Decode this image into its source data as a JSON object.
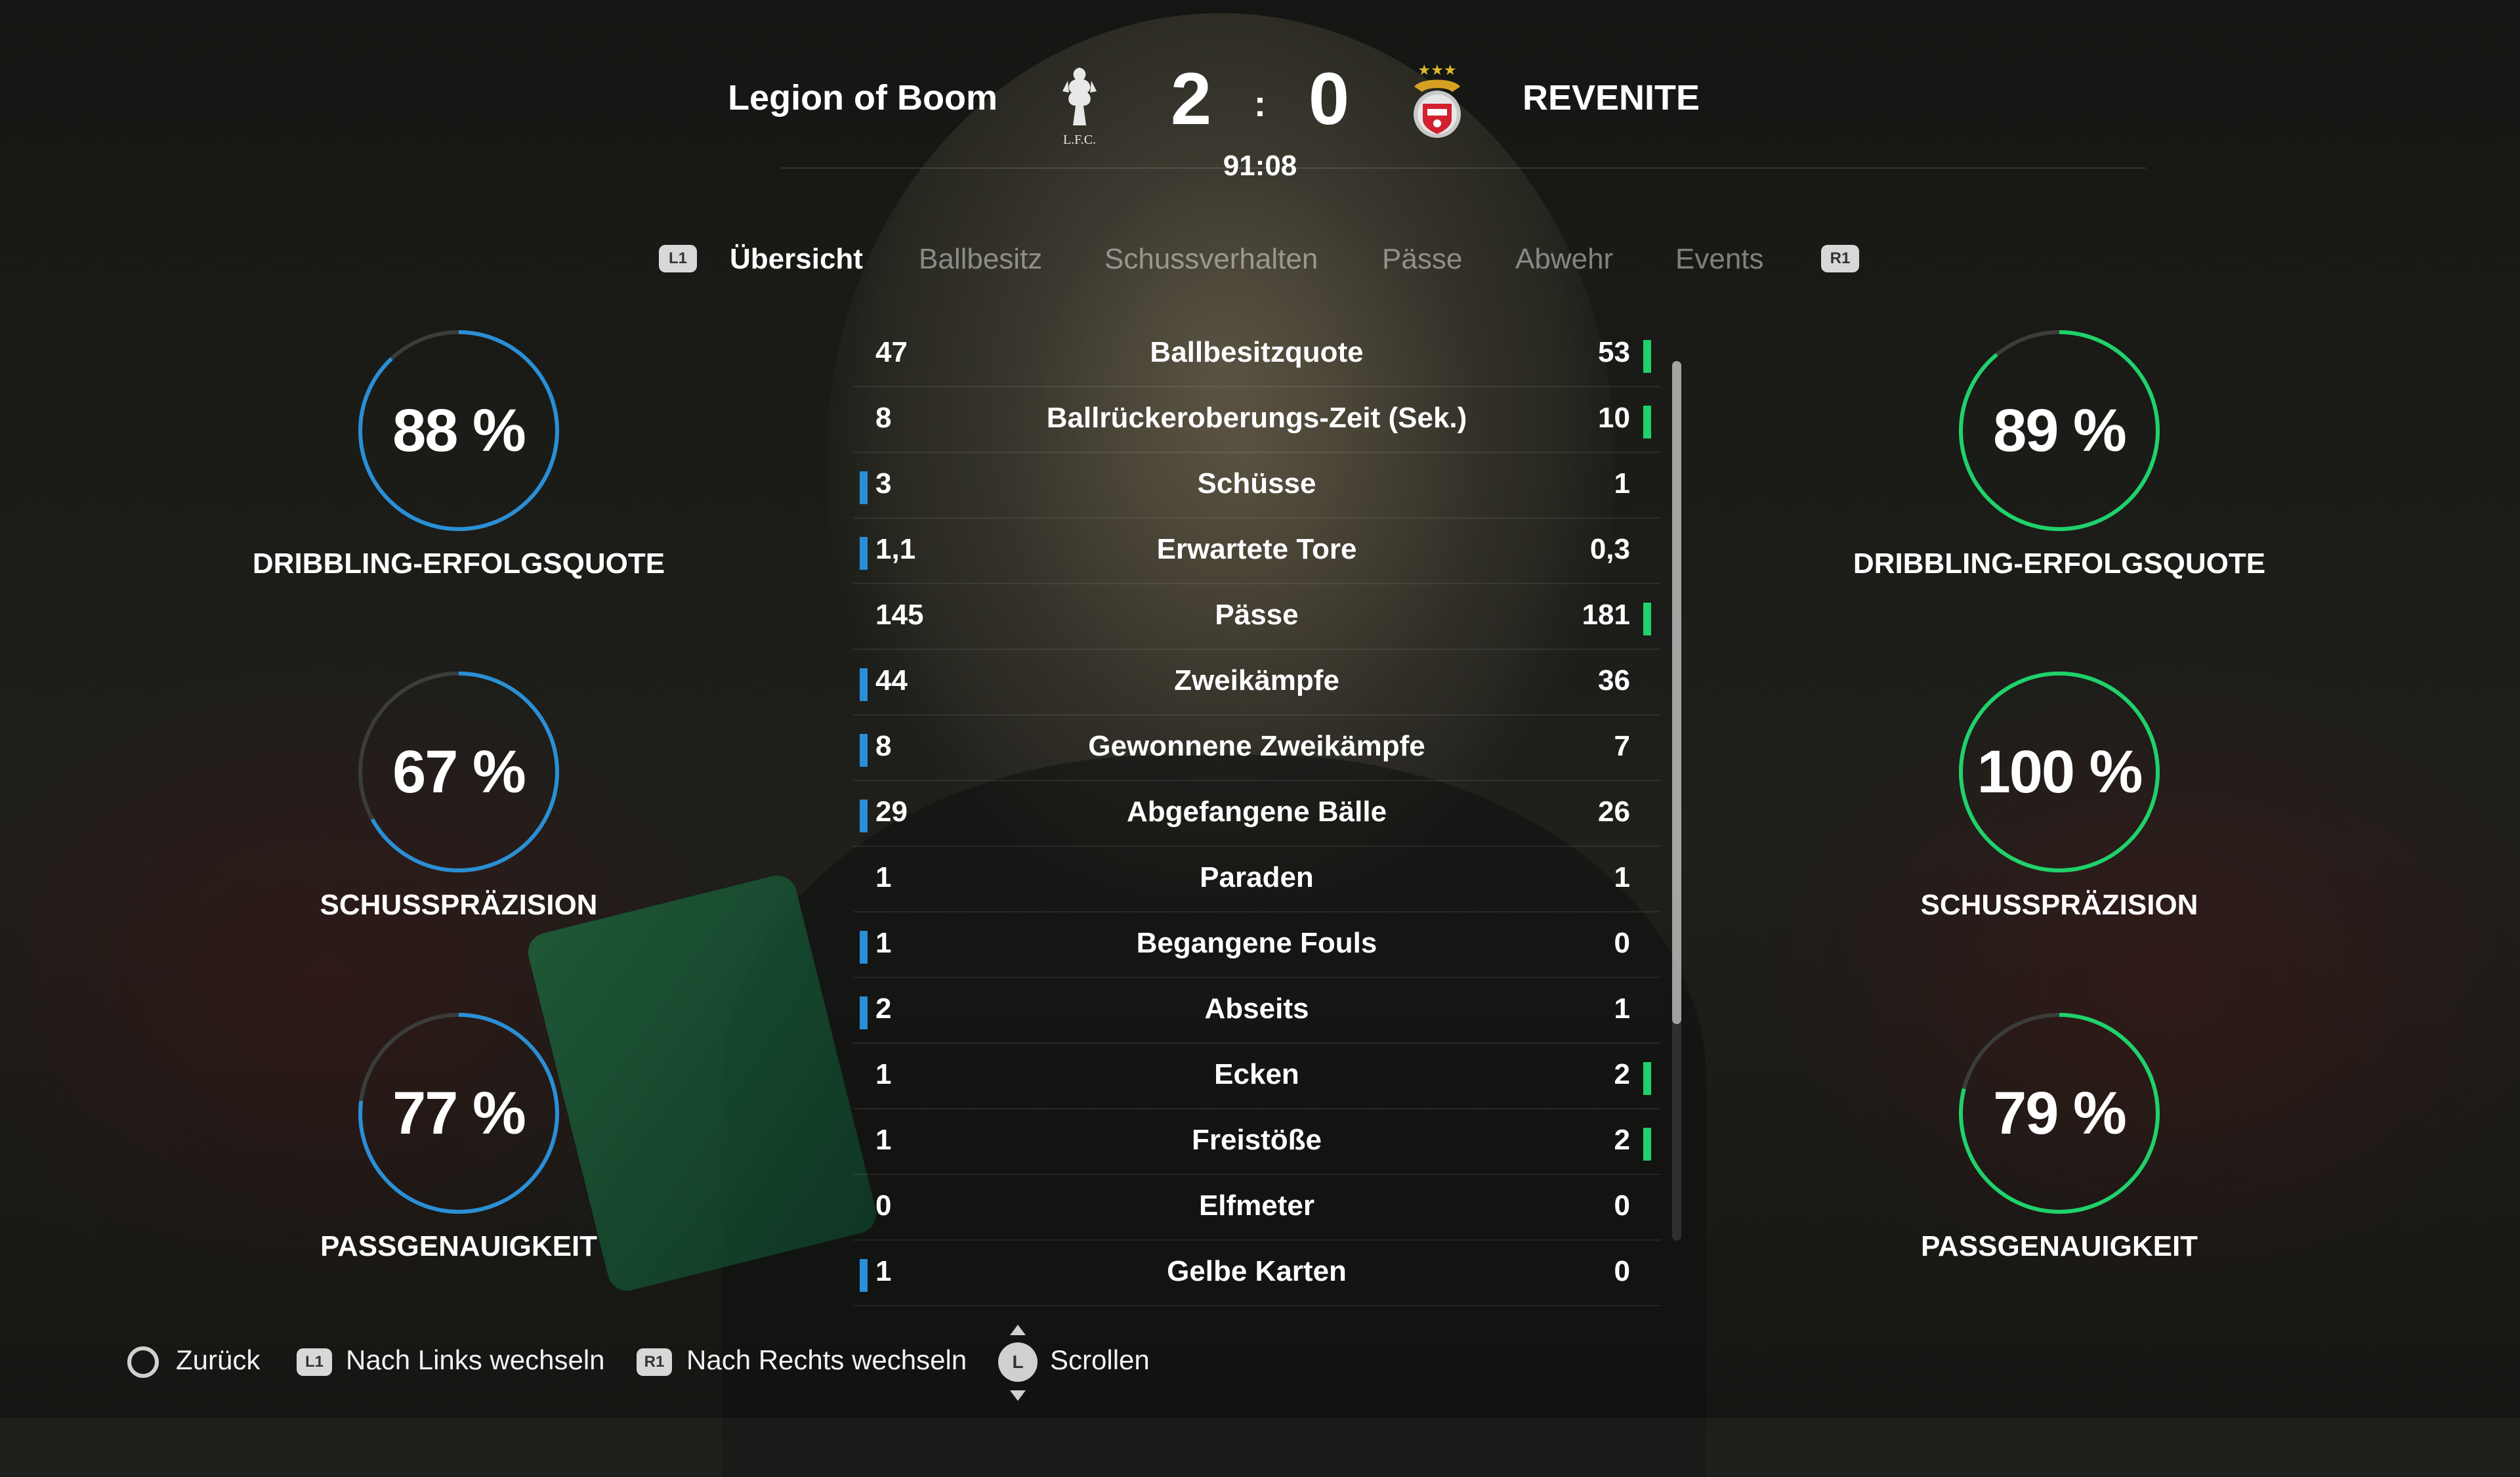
{
  "header": {
    "home_team": "Legion of Boom",
    "home_crest_text": "L.F.C.",
    "home_score": "2",
    "separator": ":",
    "away_score": "0",
    "away_team": "REVENITE",
    "clock": "91:08"
  },
  "tabs": {
    "left_key": "L1",
    "right_key": "R1",
    "items": [
      {
        "label": "Übersicht",
        "active": true
      },
      {
        "label": "Ballbesitz",
        "active": false
      },
      {
        "label": "Schussverhalten",
        "active": false
      },
      {
        "label": "Pässe",
        "active": false
      },
      {
        "label": "Abwehr",
        "active": false
      },
      {
        "label": "Events",
        "active": false
      }
    ]
  },
  "home_gauges": [
    {
      "value": "88 %",
      "fraction": 0.88,
      "label": "DRIBBLING-ERFOLGSQUOTE"
    },
    {
      "value": "67 %",
      "fraction": 0.67,
      "label": "SCHUSSPRÄZISION"
    },
    {
      "value": "77 %",
      "fraction": 0.77,
      "label": "PASSGENAUIGKEIT"
    }
  ],
  "away_gauges": [
    {
      "value": "89 %",
      "fraction": 0.89,
      "label": "DRIBBLING-ERFOLGSQUOTE"
    },
    {
      "value": "100 %",
      "fraction": 1.0,
      "label": "SCHUSSPRÄZISION"
    },
    {
      "value": "79 %",
      "fraction": 0.79,
      "label": "PASSGENAUIGKEIT"
    }
  ],
  "colors": {
    "home_accent": "#2a8fd6",
    "away_accent": "#1fd26a",
    "gauge_track": "#3a3d3a"
  },
  "stats": [
    {
      "label": "Ballbesitzquote",
      "home": "47",
      "away": "53",
      "leader": "away"
    },
    {
      "label": "Ballrückeroberungs-Zeit (Sek.)",
      "home": "8",
      "away": "10",
      "leader": "away"
    },
    {
      "label": "Schüsse",
      "home": "3",
      "away": "1",
      "leader": "home"
    },
    {
      "label": "Erwartete Tore",
      "home": "1,1",
      "away": "0,3",
      "leader": "home"
    },
    {
      "label": "Pässe",
      "home": "145",
      "away": "181",
      "leader": "away"
    },
    {
      "label": "Zweikämpfe",
      "home": "44",
      "away": "36",
      "leader": "home"
    },
    {
      "label": "Gewonnene Zweikämpfe",
      "home": "8",
      "away": "7",
      "leader": "home"
    },
    {
      "label": "Abgefangene Bälle",
      "home": "29",
      "away": "26",
      "leader": "home"
    },
    {
      "label": "Paraden",
      "home": "1",
      "away": "1",
      "leader": "none"
    },
    {
      "label": "Begangene Fouls",
      "home": "1",
      "away": "0",
      "leader": "home"
    },
    {
      "label": "Abseits",
      "home": "2",
      "away": "1",
      "leader": "home"
    },
    {
      "label": "Ecken",
      "home": "1",
      "away": "2",
      "leader": "away"
    },
    {
      "label": "Freistöße",
      "home": "1",
      "away": "2",
      "leader": "away"
    },
    {
      "label": "Elfmeter",
      "home": "0",
      "away": "0",
      "leader": "none"
    },
    {
      "label": "Gelbe Karten",
      "home": "1",
      "away": "0",
      "leader": "home"
    }
  ],
  "footer": {
    "back": "Zurück",
    "left_key": "L1",
    "left": "Nach Links wechseln",
    "right_key": "R1",
    "right": "Nach Rechts wechseln",
    "stick_key": "L",
    "scroll": "Scrollen"
  }
}
